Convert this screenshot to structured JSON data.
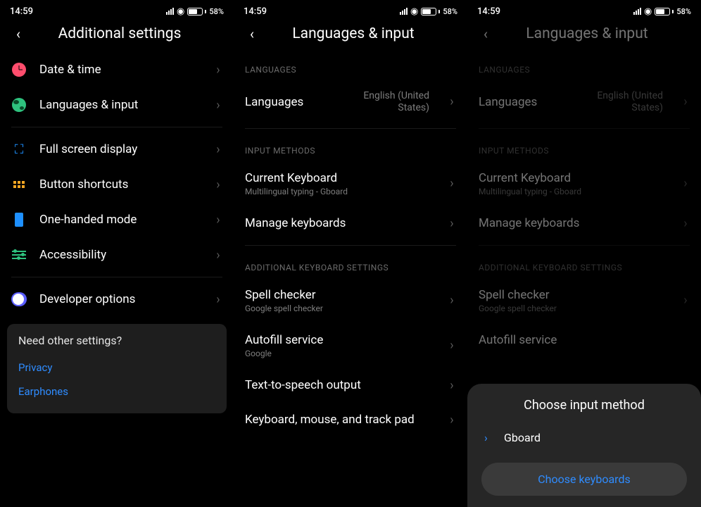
{
  "status": {
    "time": "14:59",
    "battery_pct": "58",
    "battery_suffix": "%"
  },
  "screen1": {
    "title": "Additional settings",
    "items": {
      "date_time": "Date & time",
      "lang_input": "Languages & input",
      "fullscreen": "Full screen display",
      "shortcuts": "Button shortcuts",
      "onehanded": "One-handed mode",
      "accessibility": "Accessibility",
      "developer": "Developer options"
    },
    "card": {
      "title": "Need other settings?",
      "links": {
        "privacy": "Privacy",
        "earphones": "Earphones"
      }
    }
  },
  "screen2": {
    "title": "Languages & input",
    "sections": {
      "languages": "LANGUAGES",
      "input_methods": "INPUT METHODS",
      "additional": "ADDITIONAL KEYBOARD SETTINGS"
    },
    "items": {
      "languages": {
        "label": "Languages",
        "value": "English (United States)"
      },
      "current_kb": {
        "label": "Current Keyboard",
        "sub": "Multilingual typing - Gboard"
      },
      "manage_kb": "Manage keyboards",
      "spell": {
        "label": "Spell checker",
        "sub": "Google spell checker"
      },
      "autofill": {
        "label": "Autofill service",
        "sub": "Google"
      },
      "tts": "Text-to-speech output",
      "kmt": "Keyboard, mouse, and track pad"
    }
  },
  "sheet": {
    "title": "Choose input method",
    "option": "Gboard",
    "button": "Choose keyboards"
  }
}
